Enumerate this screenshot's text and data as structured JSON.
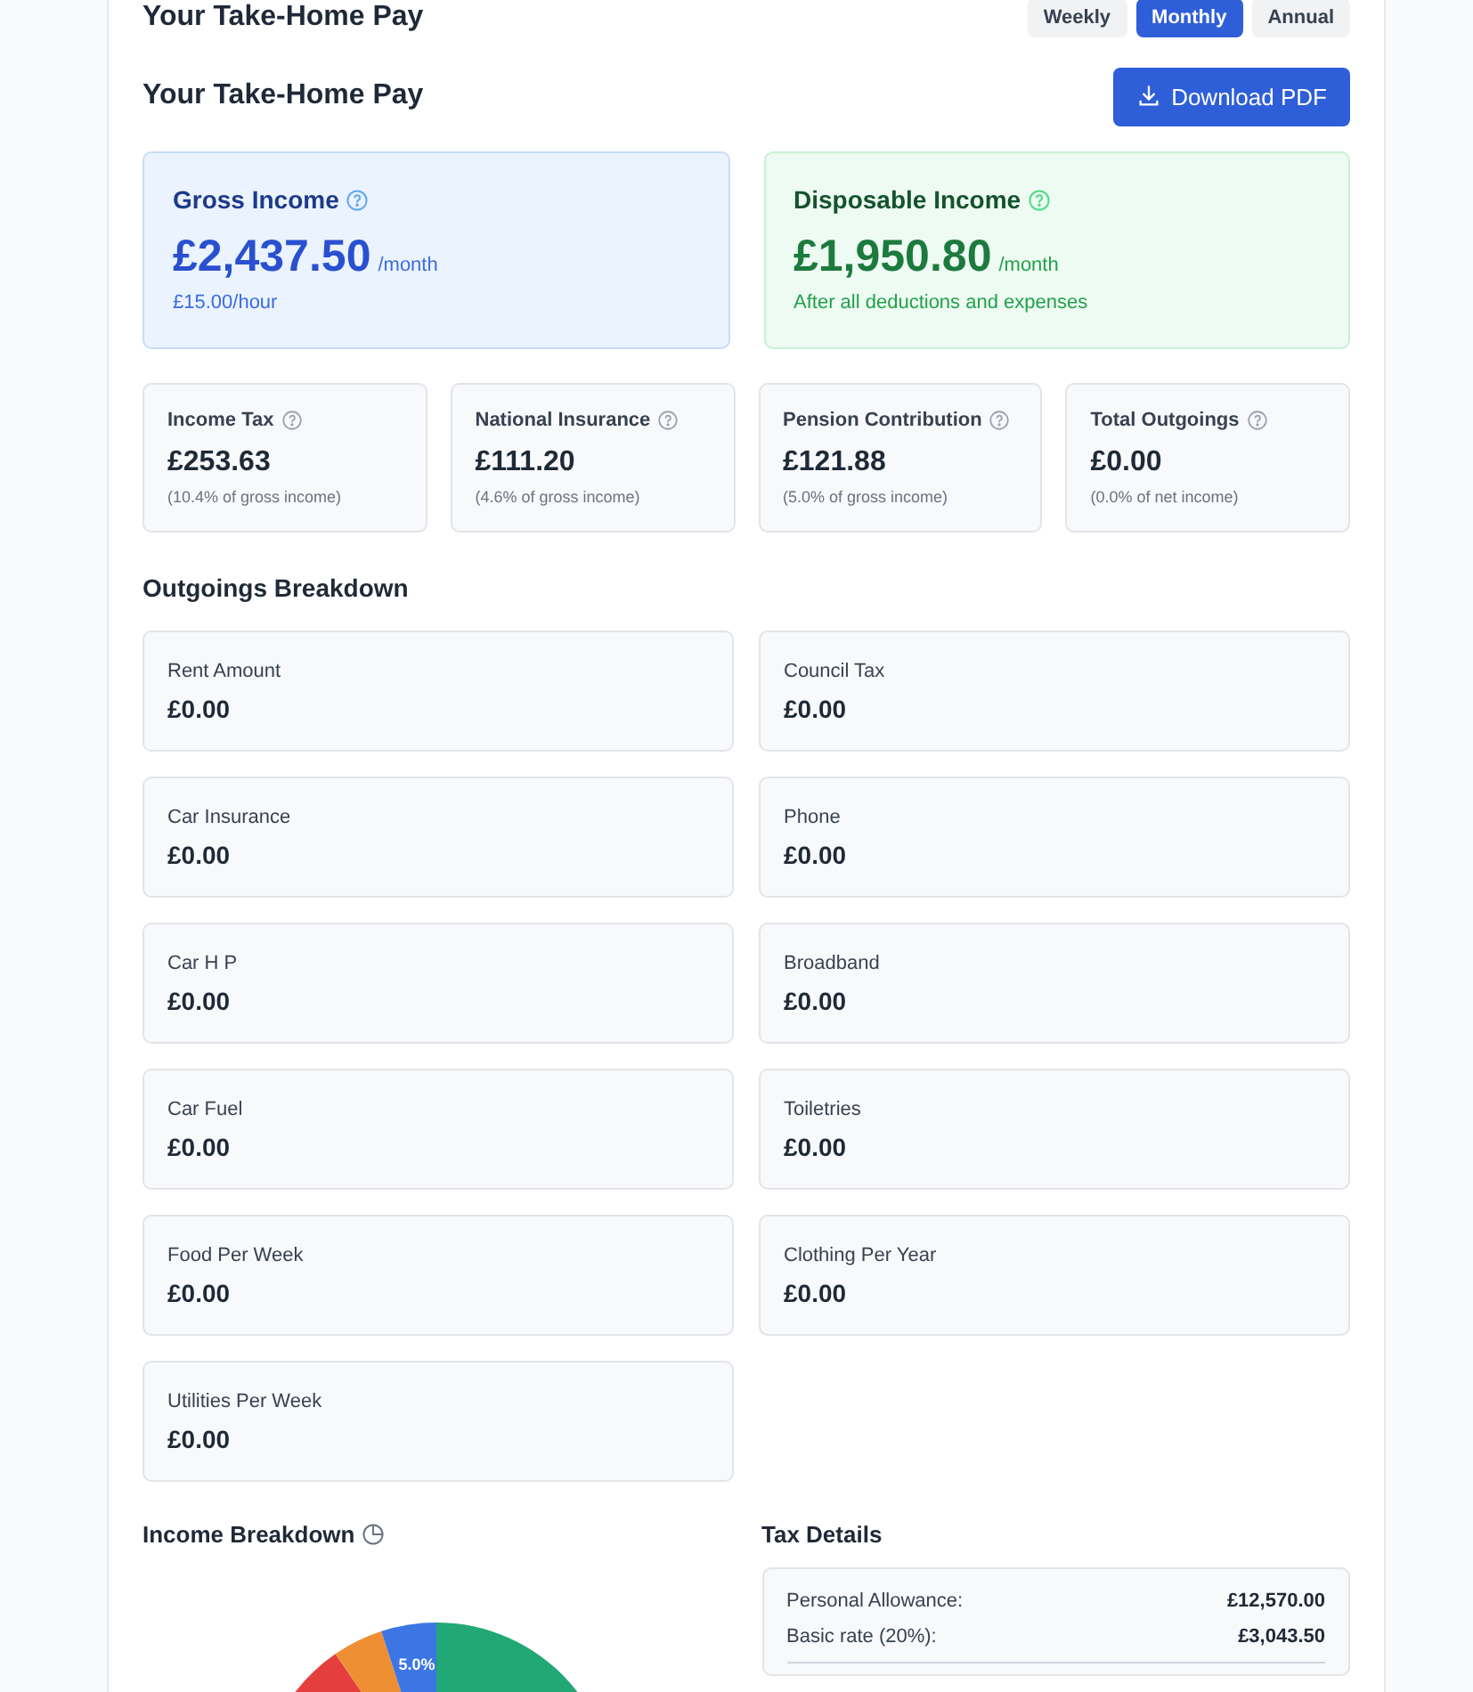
{
  "header": {
    "title": "Your Take-Home Pay",
    "periods": [
      {
        "label": "Weekly",
        "selected": false
      },
      {
        "label": "Monthly",
        "selected": true
      },
      {
        "label": "Annual",
        "selected": false
      }
    ]
  },
  "section_title": "Your Take-Home Pay",
  "download_button": "Download PDF",
  "summary": [
    {
      "kind": "gross",
      "title": "Gross Income",
      "amount": "£2,437.50",
      "unit": "/month",
      "note": "£15.00/hour"
    },
    {
      "kind": "disposable",
      "title": "Disposable Income",
      "amount": "£1,950.80",
      "unit": "/month",
      "note": "After all deductions and expenses"
    }
  ],
  "deductions": [
    {
      "title": "Income Tax",
      "amount": "£253.63",
      "note": "(10.4% of gross income)"
    },
    {
      "title": "National Insurance",
      "amount": "£111.20",
      "note": "(4.6% of gross income)"
    },
    {
      "title": "Pension Contribution",
      "amount": "£121.88",
      "note": "(5.0% of gross income)"
    },
    {
      "title": "Total Outgoings",
      "amount": "£0.00",
      "note": "(0.0% of net income)"
    }
  ],
  "outgoings": {
    "title": "Outgoings Breakdown",
    "items": [
      {
        "label": "Rent Amount",
        "amount": "£0.00"
      },
      {
        "label": "Council Tax",
        "amount": "£0.00"
      },
      {
        "label": "Car Insurance",
        "amount": "£0.00"
      },
      {
        "label": "Phone",
        "amount": "£0.00"
      },
      {
        "label": "Car H P",
        "amount": "£0.00"
      },
      {
        "label": "Broadband",
        "amount": "£0.00"
      },
      {
        "label": "Car Fuel",
        "amount": "£0.00"
      },
      {
        "label": "Toiletries",
        "amount": "£0.00"
      },
      {
        "label": "Food Per Week",
        "amount": "£0.00"
      },
      {
        "label": "Clothing Per Year",
        "amount": "£0.00"
      },
      {
        "label": "Utilities Per Week",
        "amount": "£0.00"
      }
    ]
  },
  "income_breakdown": {
    "title": "Income Breakdown",
    "slice_label": "5.0%"
  },
  "tax_details": {
    "title": "Tax Details",
    "rows": [
      {
        "label": "Personal Allowance:",
        "value": "£12,570.00"
      },
      {
        "label": "Basic rate (20%):",
        "value": "£3,043.50"
      }
    ]
  }
}
